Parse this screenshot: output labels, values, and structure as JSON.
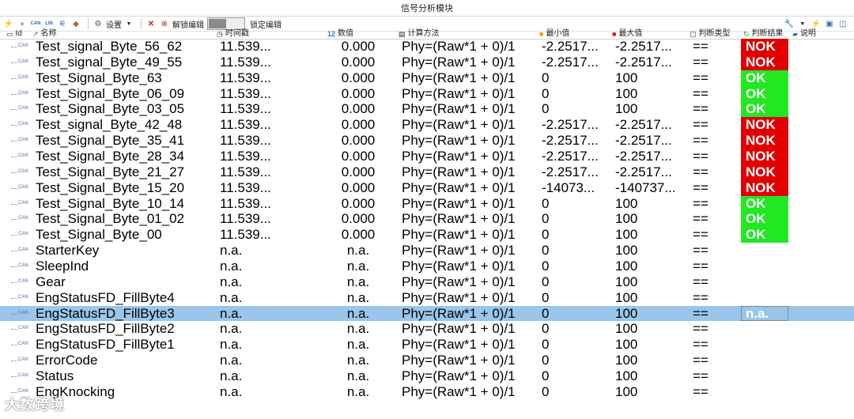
{
  "window": {
    "title": "信号分析模块"
  },
  "toolbar": {
    "settings_label": "设置",
    "unlock_edit_label": "解锁编辑",
    "lock_edit_label": "锁定编辑",
    "can_label_1": "CAN",
    "can_label_2": "LIN"
  },
  "columns": {
    "id": "Id",
    "name": "名称",
    "time": "时间戳",
    "value": "数值",
    "value_icon": "12",
    "calc": "计算方法",
    "min": "最小值",
    "max": "最大值",
    "judge_type": "判断类型",
    "judge_result": "判断结果",
    "desc": "说明"
  },
  "tree_icon_label": "CAN",
  "colors": {
    "ok": "#22e822",
    "nok": "#e00000",
    "selected": "#99c6ea"
  },
  "rows": [
    {
      "name": "Test_signal_Byte_56_62",
      "time": "11.539...",
      "value": "0.000",
      "calc": "Phy=(Raw*1 + 0)/1",
      "min": "-2.2517...",
      "max": "-2.2517...",
      "op": "==",
      "result": "NOK"
    },
    {
      "name": "Test_signal_Byte_49_55",
      "time": "11.539...",
      "value": "0.000",
      "calc": "Phy=(Raw*1 + 0)/1",
      "min": "-2.2517...",
      "max": "-2.2517...",
      "op": "==",
      "result": "NOK"
    },
    {
      "name": "Test_Signal_Byte_63",
      "time": "11.539...",
      "value": "0.000",
      "calc": "Phy=(Raw*1 + 0)/1",
      "min": "0",
      "max": "100",
      "op": "==",
      "result": "OK"
    },
    {
      "name": "Test_Signal_Byte_06_09",
      "time": "11.539...",
      "value": "0.000",
      "calc": "Phy=(Raw*1 + 0)/1",
      "min": "0",
      "max": "100",
      "op": "==",
      "result": "OK"
    },
    {
      "name": "Test_Signal_Byte_03_05",
      "time": "11.539...",
      "value": "0.000",
      "calc": "Phy=(Raw*1 + 0)/1",
      "min": "0",
      "max": "100",
      "op": "==",
      "result": "OK"
    },
    {
      "name": "Test_signal_Byte_42_48",
      "time": "11.539...",
      "value": "0.000",
      "calc": "Phy=(Raw*1 + 0)/1",
      "min": "-2.2517...",
      "max": "-2.2517...",
      "op": "==",
      "result": "NOK"
    },
    {
      "name": "Test_Signal_Byte_35_41",
      "time": "11.539...",
      "value": "0.000",
      "calc": "Phy=(Raw*1 + 0)/1",
      "min": "-2.2517...",
      "max": "-2.2517...",
      "op": "==",
      "result": "NOK"
    },
    {
      "name": "Test_Signal_Byte_28_34",
      "time": "11.539...",
      "value": "0.000",
      "calc": "Phy=(Raw*1 + 0)/1",
      "min": "-2.2517...",
      "max": "-2.2517...",
      "op": "==",
      "result": "NOK"
    },
    {
      "name": "Test_Signal_Byte_21_27",
      "time": "11.539...",
      "value": "0.000",
      "calc": "Phy=(Raw*1 + 0)/1",
      "min": "-2.2517...",
      "max": "-2.2517...",
      "op": "==",
      "result": "NOK"
    },
    {
      "name": "Test_Signal_Byte_15_20",
      "time": "11.539...",
      "value": "0.000",
      "calc": "Phy=(Raw*1 + 0)/1",
      "min": "-14073...",
      "max": "-140737...",
      "op": "==",
      "result": "NOK"
    },
    {
      "name": "Test_Signal_Byte_10_14",
      "time": "11.539...",
      "value": "0.000",
      "calc": "Phy=(Raw*1 + 0)/1",
      "min": "0",
      "max": "100",
      "op": "==",
      "result": "OK"
    },
    {
      "name": "Test_Signal_Byte_01_02",
      "time": "11.539...",
      "value": "0.000",
      "calc": "Phy=(Raw*1 + 0)/1",
      "min": "0",
      "max": "100",
      "op": "==",
      "result": "OK"
    },
    {
      "name": "Test_Signal_Byte_00",
      "time": "11.539...",
      "value": "0.000",
      "calc": "Phy=(Raw*1 + 0)/1",
      "min": "0",
      "max": "100",
      "op": "==",
      "result": "OK"
    },
    {
      "name": "StarterKey",
      "time": "n.a.",
      "value": "n.a.",
      "calc": "Phy=(Raw*1 + 0)/1",
      "min": "0",
      "max": "100",
      "op": "==",
      "result": ""
    },
    {
      "name": "SleepInd",
      "time": "n.a.",
      "value": "n.a.",
      "calc": "Phy=(Raw*1 + 0)/1",
      "min": "0",
      "max": "100",
      "op": "==",
      "result": ""
    },
    {
      "name": "Gear",
      "time": "n.a.",
      "value": "n.a.",
      "calc": "Phy=(Raw*1 + 0)/1",
      "min": "0",
      "max": "100",
      "op": "==",
      "result": ""
    },
    {
      "name": "EngStatusFD_FillByte4",
      "time": "n.a.",
      "value": "n.a.",
      "calc": "Phy=(Raw*1 + 0)/1",
      "min": "0",
      "max": "100",
      "op": "==",
      "result": ""
    },
    {
      "name": "EngStatusFD_FillByte3",
      "time": "n.a.",
      "value": "n.a.",
      "calc": "Phy=(Raw*1 + 0)/1",
      "min": "0",
      "max": "100",
      "op": "==",
      "result": "n.a.",
      "selected": true
    },
    {
      "name": "EngStatusFD_FillByte2",
      "time": "n.a.",
      "value": "n.a.",
      "calc": "Phy=(Raw*1 + 0)/1",
      "min": "0",
      "max": "100",
      "op": "==",
      "result": ""
    },
    {
      "name": "EngStatusFD_FillByte1",
      "time": "n.a.",
      "value": "n.a.",
      "calc": "Phy=(Raw*1 + 0)/1",
      "min": "0",
      "max": "100",
      "op": "==",
      "result": ""
    },
    {
      "name": "ErrorCode",
      "time": "n.a.",
      "value": "n.a.",
      "calc": "Phy=(Raw*1 + 0)/1",
      "min": "0",
      "max": "100",
      "op": "==",
      "result": ""
    },
    {
      "name": "Status",
      "time": "n.a.",
      "value": "n.a.",
      "calc": "Phy=(Raw*1 + 0)/1",
      "min": "0",
      "max": "100",
      "op": "==",
      "result": ""
    },
    {
      "name": "EngKnocking",
      "time": "n.a.",
      "value": "n.a.",
      "calc": "Phy=(Raw*1 + 0)/1",
      "min": "0",
      "max": "100",
      "op": "==",
      "result": ""
    }
  ],
  "watermark": "大数跨境"
}
